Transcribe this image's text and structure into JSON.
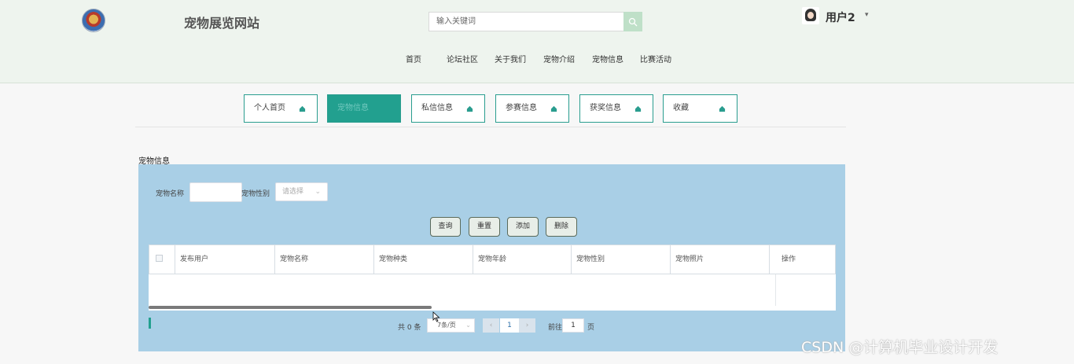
{
  "header": {
    "site_title": "宠物展览网站",
    "search": {
      "placeholder": "输入关键词",
      "value": ""
    },
    "search_icon": "search-icon",
    "user": {
      "name": "用户2",
      "avatar_icon": "avatar-icon",
      "caret": "▾"
    }
  },
  "nav": [
    "首页",
    "论坛社区",
    "关于我们",
    "宠物介绍",
    "宠物信息",
    "比赛活动"
  ],
  "tabs": [
    {
      "label": "个人首页",
      "active": false
    },
    {
      "label": "宠物信息",
      "active": true
    },
    {
      "label": "私信信息",
      "active": false
    },
    {
      "label": "参赛信息",
      "active": false
    },
    {
      "label": "获奖信息",
      "active": false
    },
    {
      "label": "收藏",
      "active": false
    }
  ],
  "section": {
    "title": "宠物信息"
  },
  "filters": {
    "name_label": "宠物名称",
    "name_value": "",
    "gender_label": "宠物性别",
    "gender_placeholder": "请选择"
  },
  "buttons": {
    "query": "查询",
    "reset": "重置",
    "add": "添加",
    "delete": "删除"
  },
  "table": {
    "columns": [
      "发布用户",
      "宠物名称",
      "宠物种类",
      "宠物年龄",
      "宠物性别",
      "宠物照片"
    ],
    "action_column": "操作",
    "rows": []
  },
  "pagination": {
    "total": "共 0 条",
    "page_size": "7条/页",
    "prev": "‹",
    "current": "1",
    "next": "›",
    "goto_label": "前往",
    "goto_value": "1",
    "page_suffix": "页"
  },
  "watermark": "CSDN @计算机毕业设计开发",
  "colors": {
    "accent": "#22a08f",
    "panel": "#a9cfe6",
    "header_bg": "#eef4ee"
  }
}
